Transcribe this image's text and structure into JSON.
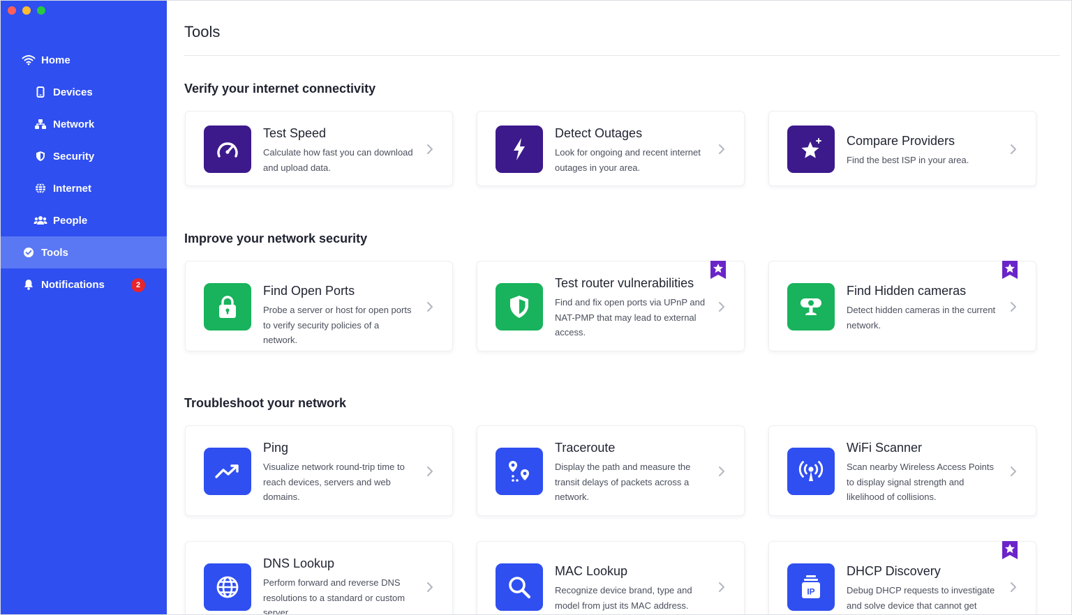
{
  "sidebar": {
    "items": [
      {
        "label": "Home",
        "icon": "wifi-icon"
      },
      {
        "label": "Devices",
        "icon": "phone-icon"
      },
      {
        "label": "Network",
        "icon": "network-icon"
      },
      {
        "label": "Security",
        "icon": "shield-icon"
      },
      {
        "label": "Internet",
        "icon": "globe-icon"
      },
      {
        "label": "People",
        "icon": "people-icon"
      },
      {
        "label": "Tools",
        "icon": "check-circle-icon"
      },
      {
        "label": "Notifications",
        "icon": "bell-icon",
        "badge": "2"
      }
    ],
    "active": "Tools",
    "accent": "#2f4ff0",
    "active_bg": "#5a78f4",
    "badge_color": "#e5262e"
  },
  "main": {
    "title": "Tools",
    "sections": [
      {
        "title": "Verify your internet connectivity",
        "cards": [
          {
            "name": "Test Speed",
            "desc": "Calculate how fast you can download and upload data.",
            "icon": "speedometer-icon",
            "color": "#3c1a8c"
          },
          {
            "name": "Detect Outages",
            "desc": "Look for ongoing and recent internet outages in your area.",
            "icon": "lightning-icon",
            "color": "#3c1a8c"
          },
          {
            "name": "Compare Providers",
            "desc": "Find the best ISP in your area.",
            "icon": "star-sparkle-icon",
            "color": "#3c1a8c"
          }
        ]
      },
      {
        "title": "Improve your network security",
        "cards": [
          {
            "name": "Find Open Ports",
            "desc": "Probe a server or host for open ports to verify security policies of a network.",
            "icon": "lock-icon",
            "color": "#18b35c"
          },
          {
            "name": "Test router vulnerabilities",
            "desc": "Find and fix open ports via UPnP and NAT-PMP that may lead to external access.",
            "icon": "shield-icon",
            "color": "#18b35c",
            "premium": true
          },
          {
            "name": "Find Hidden cameras",
            "desc": "Detect hidden cameras in the current network.",
            "icon": "camera-icon",
            "color": "#18b35c",
            "premium": true
          }
        ]
      },
      {
        "title": "Troubleshoot your network",
        "cards": [
          {
            "name": "Ping",
            "desc": "Visualize network round-trip time to reach devices, servers and web domains.",
            "icon": "trend-up-icon",
            "color": "#2f4ff0"
          },
          {
            "name": "Traceroute",
            "desc": "Display the path and measure the transit delays of packets across a network.",
            "icon": "route-icon",
            "color": "#2f4ff0"
          },
          {
            "name": "WiFi Scanner",
            "desc": "Scan nearby Wireless Access Points to display signal strength and likelihood of collisions.",
            "icon": "broadcast-icon",
            "color": "#2f4ff0"
          },
          {
            "name": "DNS Lookup",
            "desc": "Perform forward and reverse DNS resolutions to a standard or custom server.",
            "icon": "globe-icon",
            "color": "#2f4ff0"
          },
          {
            "name": "MAC Lookup",
            "desc": "Recognize device brand, type and model from just its MAC address.",
            "icon": "search-icon",
            "color": "#2f4ff0"
          },
          {
            "name": "DHCP Discovery",
            "desc": "Debug DHCP requests to investigate and solve device that cannot get online.",
            "icon": "ip-icon",
            "color": "#2f4ff0",
            "premium": true
          }
        ]
      }
    ],
    "premium_color": "#6a25c9"
  }
}
